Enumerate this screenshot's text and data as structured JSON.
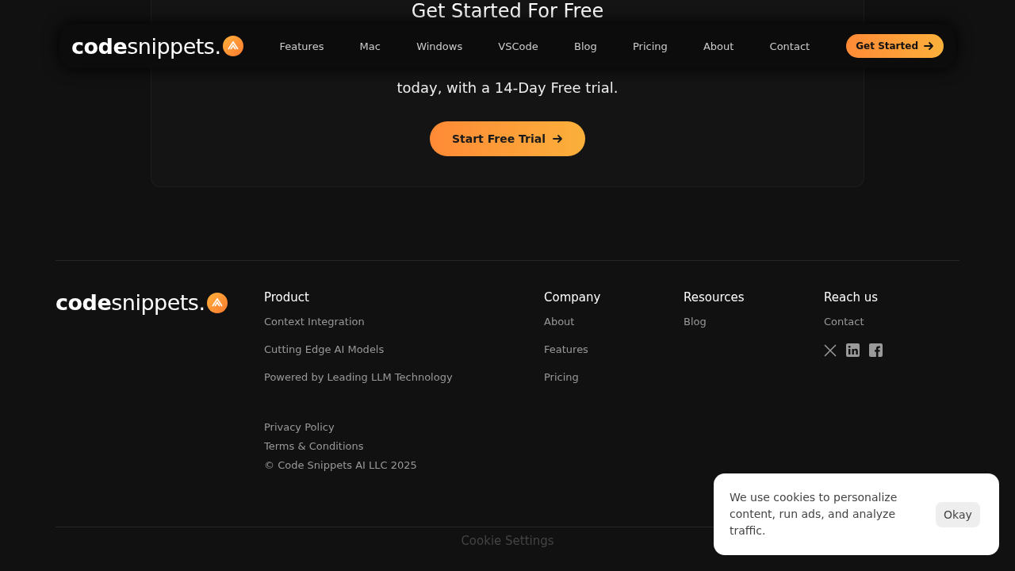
{
  "hero": {
    "title": "Get Started For Free",
    "subtitle": "today, with a 14-Day Free trial.",
    "cta": "Start Free Trial"
  },
  "nav": {
    "logo": "**code**snippets.",
    "links": [
      "Features",
      "Mac",
      "Windows",
      "VSCode",
      "Blog",
      "Pricing",
      "About",
      "Contact"
    ],
    "cta": "Get Started"
  },
  "footer": {
    "logo": "**code**snippets.",
    "columns": [
      {
        "title": "Product",
        "links": [
          "Context Integration",
          "Cutting Edge AI Models",
          "Powered by Leading LLM Technology"
        ]
      },
      {
        "title": "Company",
        "links": [
          "About",
          "Features",
          "Pricing"
        ]
      },
      {
        "title": "Resources",
        "links": [
          "Blog"
        ]
      },
      {
        "title": "Reach us",
        "links": [
          "Contact"
        ],
        "social": [
          {
            "kind": "x"
          },
          {
            "kind": "linkedin"
          },
          {
            "kind": "facebook"
          }
        ]
      }
    ],
    "legal": [
      "Privacy Policy",
      "Terms & Conditions"
    ],
    "copyright": "© Code Snippets AI LLC 2025",
    "cookie_settings": "Cookie Settings"
  },
  "cookie_banner": {
    "text": "We use cookies to personalize content, run ads, and analyze traffic.",
    "button": "Okay"
  }
}
